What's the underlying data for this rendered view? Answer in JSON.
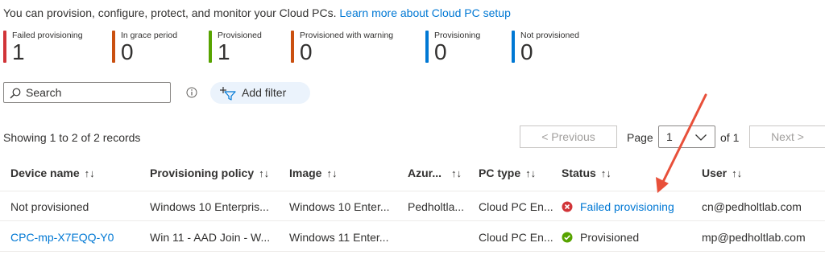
{
  "intro": {
    "text": "You can provision, configure, protect, and monitor your Cloud PCs.",
    "link": "Learn more about Cloud PC setup"
  },
  "tiles": [
    {
      "label": "Failed provisioning",
      "value": "1",
      "color": "#d13438"
    },
    {
      "label": "In grace period",
      "value": "0",
      "color": "#ca5010"
    },
    {
      "label": "Provisioned",
      "value": "1",
      "color": "#57a300"
    },
    {
      "label": "Provisioned with warning",
      "value": "0",
      "color": "#ca5010"
    },
    {
      "label": "Provisioning",
      "value": "0",
      "color": "#0078d4"
    },
    {
      "label": "Not provisioned",
      "value": "0",
      "color": "#0078d4"
    }
  ],
  "search": {
    "placeholder": "Search"
  },
  "add_filter_label": "Add filter",
  "records": {
    "showing": "Showing 1 to 2 of 2 records"
  },
  "pagination": {
    "previous": "< Previous",
    "page_label": "Page",
    "page_value": "1",
    "of_label": "of 1",
    "next": "Next >"
  },
  "table": {
    "columns": [
      "Device name",
      "Provisioning policy",
      "Image",
      "Azur...",
      "PC type",
      "Status",
      "User"
    ],
    "sort_glyph": "↑↓",
    "rows": [
      {
        "device": "Not provisioned",
        "policy": "Windows 10 Enterpris...",
        "image": "Windows 10 Enter...",
        "azure": "Pedholtla...",
        "pctype": "Cloud PC En...",
        "status": "Failed provisioning",
        "user": "cn@pedholtlab.com"
      },
      {
        "device": "CPC-mp-X7EQQ-Y0",
        "policy": "Win 11 - AAD Join - W...",
        "image": "Windows 11 Enter...",
        "azure": "",
        "pctype": "Cloud PC En...",
        "status": "Provisioned",
        "user": "mp@pedholtlab.com"
      }
    ]
  },
  "colors": {
    "link": "#0078d4",
    "error": "#d13438",
    "success": "#57a300",
    "annotation_arrow": "#e8503a"
  },
  "icons": {
    "search": "search-icon",
    "info": "info-icon",
    "filter": "add-filter-icon",
    "error": "error-circle-icon",
    "success": "check-circle-icon",
    "chevron": "chevron-down-icon"
  }
}
